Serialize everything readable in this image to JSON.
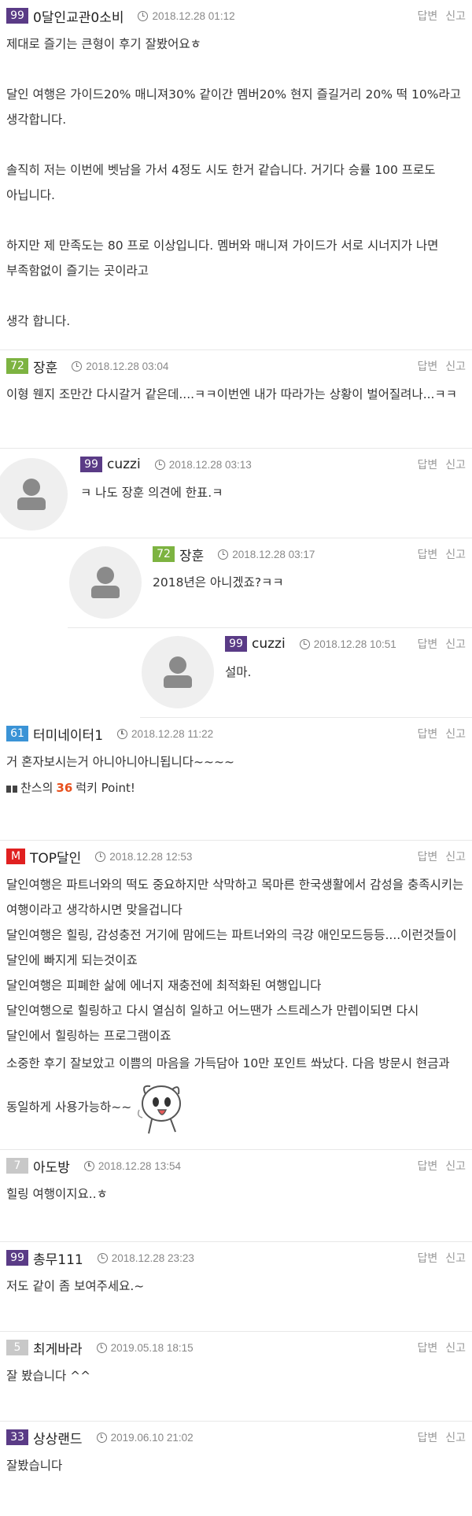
{
  "actions": {
    "reply": "답변",
    "report": "신고"
  },
  "comments": [
    {
      "level": "99",
      "level_color": "#5a3b86",
      "nick": "0달인교관0소비",
      "date": "2018.12.28 01:12",
      "paragraphs": [
        "제대로 즐기는 큰형이 후기 잘봤어요ㅎ",
        "달인 여행은 가이드20% 매니져30% 같이간 멤버20% 현지 즐길거리 20% 떡 10%라고 생각합니다.",
        "솔직히 저는 이번에 벳남을 가서 4정도 시도 한거 같습니다. 거기다 승률 100 프로도 아닙니다.",
        "하지만 제 만족도는 80 프로 이상입니다. 멤버와 매니져 가이드가 서로 시너지가 나면 부족함없이 즐기는 곳이라고",
        "생각 합니다."
      ]
    },
    {
      "level": "72",
      "level_color": "#7db341",
      "nick": "장훈",
      "date": "2018.12.28 03:04",
      "text": "이형 웬지 조만간 다시갈거 같은데....ㅋㅋ이번엔 내가 따라가는 상황이 벌어질려나...ㅋㅋ"
    },
    {
      "level": "99",
      "level_color": "#5a3b86",
      "nick": "cuzzi",
      "date": "2018.12.28 03:13",
      "text": "ㅋ 나도 장훈 의견에 한표.ㅋ"
    },
    {
      "level": "72",
      "level_color": "#7db341",
      "nick": "장훈",
      "date": "2018.12.28 03:17",
      "text": "2018년은 아니겠죠?ㅋㅋ"
    },
    {
      "level": "99",
      "level_color": "#5a3b86",
      "nick": "cuzzi",
      "date": "2018.12.28 10:51",
      "text": "설마."
    },
    {
      "level": "61",
      "level_color": "#3a93d6",
      "nick": "터미네이터1",
      "date": "2018.12.28 11:22",
      "text": "거 혼자보시는거 아니아니아니됩니다~~~~",
      "lucky": {
        "prefix": "찬스의",
        "number": "36",
        "suffix": "럭키 Point!"
      }
    },
    {
      "level": "M",
      "level_color": "#e02020",
      "nick": "TOP달인",
      "date": "2018.12.28 12:53",
      "lines": [
        "달인여행은 파트너와의 떡도 중요하지만 삭막하고 목마른 한국생활에서 감성을 충족시키는 여행이라고 생각하시면 맞을겁니다",
        "달인여행은 힐링, 감성충전 거기에 맘에드는 파트너와의 극강 애인모드등등....이런것들이 달인에 빠지게 되는것이죠",
        "달인여행은 피폐한 삶에 에너지 재충전에 최적화된 여행입니다",
        "달인여행으로 힐링하고 다시 열심히 일하고 어느땐가 스트레스가 만렙이되면 다시 달인에서 힐링하는 프로그램이죠",
        "소중한 후기 잘보았고 이쁨의 마음을 가득담아 10만 포인트 쏴났다. 다음 방문시 현금과 동일하게 사용가능하~~"
      ]
    },
    {
      "level": "7",
      "level_color": "#c8c8c8",
      "nick": "아도방",
      "date": "2018.12.28 13:54",
      "text": "힐링 여행이지요..ㅎ"
    },
    {
      "level": "99",
      "level_color": "#5a3b86",
      "nick": "총무111",
      "date": "2018.12.28 23:23",
      "text": "저도 같이 좀 보여주세요.~"
    },
    {
      "level": "5",
      "level_color": "#c8c8c8",
      "nick": "최게바라",
      "date": "2019.05.18 18:15",
      "text": "잘 봤습니다 ^^"
    },
    {
      "level": "33",
      "level_color": "#5a3b86",
      "nick": "상상랜드",
      "date": "2019.06.10 21:02",
      "text": "잘봤습니다"
    }
  ]
}
